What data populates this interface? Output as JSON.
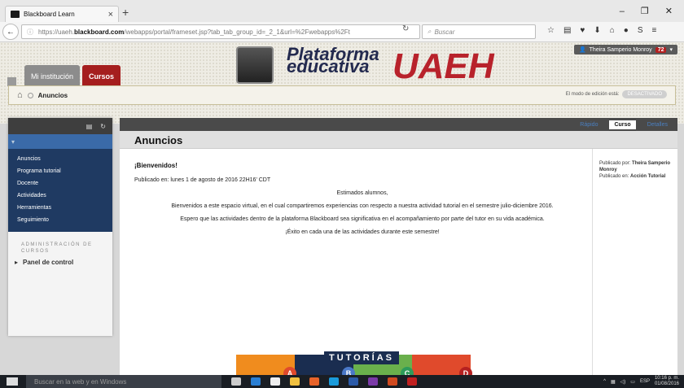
{
  "browser": {
    "tab_title": "Blackboard Learn",
    "url_prefix": "https://uaeh.",
    "url_domain": "blackboard.com",
    "url_rest": "/webapps/portal/frameset.jsp?tab_tab_group_id=_2_1&url=%2Fwebapps%2Ft",
    "search_placeholder": "Buscar"
  },
  "header": {
    "user_name": "Theira Samperio Monroy",
    "notification_count": "72",
    "logo_line1": "Plataforma",
    "logo_line2": "educativa",
    "logo_big": "UAEH",
    "tab_institucion": "Mi institución",
    "tab_cursos": "Cursos",
    "breadcrumb": "Anuncios",
    "edit_mode_label": "El modo de edición está:",
    "edit_mode_state": "DESACTIVADO"
  },
  "sidebar": {
    "items": [
      {
        "label": "Anuncios"
      },
      {
        "label": "Programa tutorial"
      },
      {
        "label": "Docente"
      },
      {
        "label": "Actividades"
      },
      {
        "label": "Herramientas"
      },
      {
        "label": "Seguimiento"
      }
    ],
    "admin_heading": "ADMINISTRACIÓN DE CURSOS",
    "panel": "Panel de control"
  },
  "content": {
    "tabs": {
      "left": "Rápido",
      "curso": "Curso",
      "right": "Detalles"
    },
    "title": "Anuncios",
    "announcement": {
      "heading": "¡Bienvenidos!",
      "date": "Publicado en: lunes 1 de agosto de 2016 22H16' CDT",
      "p1": "Estimados alumnos,",
      "p2": "Bienvenidos a este espacio virtual, en el cual compartiremos experiencias con respecto a nuestra actividad tutorial en el semestre julio-diciembre 2016.",
      "p3": "Espero que las actividades dentro de la plataforma Blackboard sea significativa en el acompañamiento por parte del tutor en su vida académica.",
      "p4": "¡Éxito en cada una de las actividades durante este semestre!"
    },
    "meta": {
      "posted_by_label": "Publicado por:",
      "posted_by": "Theira Samperio Monroy",
      "posted_in_label": "Publicado en:",
      "posted_in": "Acción Tutorial"
    },
    "banner": {
      "title": "TUTORÍAS",
      "letters": [
        "A",
        "B",
        "C",
        "D"
      ]
    }
  },
  "taskbar": {
    "search": "Buscar en la web y en Windows",
    "lang": "ESP",
    "time": "10:16 p. m.",
    "date": "01/08/2016"
  },
  "colors": {
    "accent": "#a51e1e",
    "nav": "#1f3a62",
    "brand": "#232a4f"
  }
}
